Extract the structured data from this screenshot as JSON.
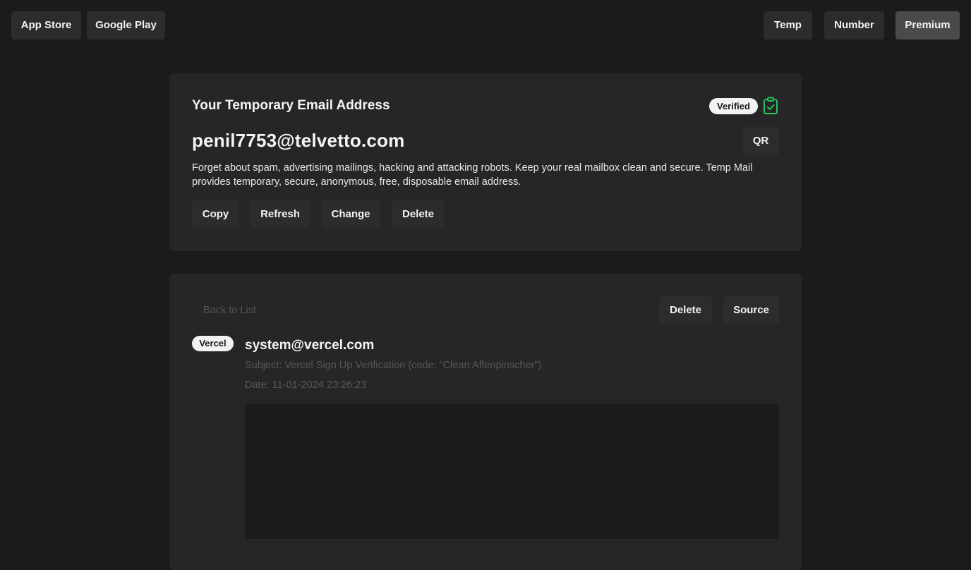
{
  "header": {
    "app_store": "App Store",
    "google_play": "Google Play",
    "temp": "Temp",
    "number": "Number",
    "premium": "Premium"
  },
  "address_card": {
    "title": "Your Temporary Email Address",
    "verified": "Verified",
    "email": "penil7753@telvetto.com",
    "qr_label": "QR",
    "description": "Forget about spam, advertising mailings, hacking and attacking robots. Keep your real mailbox clean and secure. Temp Mail provides temporary, secure, anonymous, free, disposable email address.",
    "actions": {
      "copy": "Copy",
      "refresh": "Refresh",
      "change": "Change",
      "delete": "Delete"
    }
  },
  "message": {
    "back": "Back to List",
    "delete": "Delete",
    "source": "Source",
    "sender_name": "Vercel",
    "sender_email": "system@vercel.com",
    "subject": "Subject: Vercel Sign Up Verification (code: \"Clean Affenpinscher\")",
    "date": "Date: 11-01-2024 23:26:23"
  },
  "colors": {
    "background": "#1b1b1b",
    "card": "#262626",
    "button": "#2c2c2c",
    "verified_icon": "#22c55e"
  },
  "icons": {
    "verified": "clipboard-check-icon"
  }
}
